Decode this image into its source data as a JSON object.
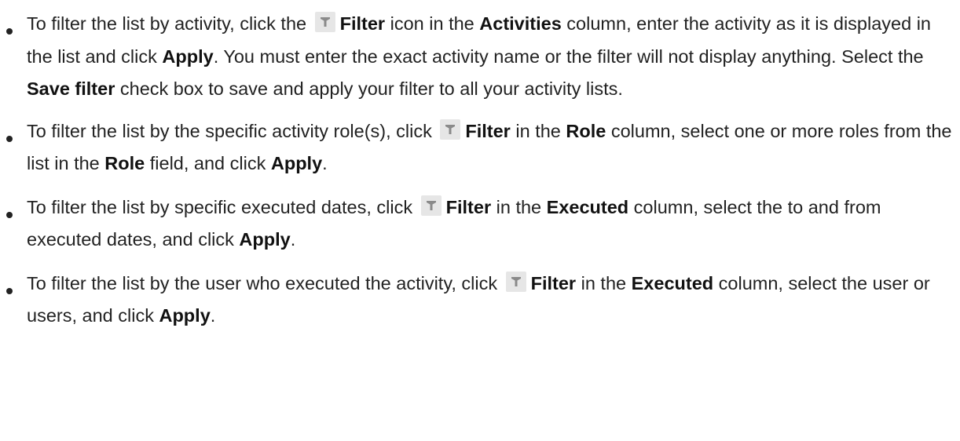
{
  "bullets": [
    {
      "segments": [
        {
          "t": "text",
          "v": "To filter the list by activity, click the "
        },
        {
          "t": "icon",
          "v": "filter-icon"
        },
        {
          "t": "bold",
          "v": "Filter"
        },
        {
          "t": "text",
          "v": " icon in the "
        },
        {
          "t": "bold",
          "v": "Activities"
        },
        {
          "t": "text",
          "v": " column, enter the activity as it is displayed in the list and click "
        },
        {
          "t": "bold",
          "v": "Apply"
        },
        {
          "t": "text",
          "v": ". You must enter the exact activity name or the filter will not display anything. Select the "
        },
        {
          "t": "bold",
          "v": "Save filter"
        },
        {
          "t": "text",
          "v": " check box to save and apply your filter to all your activity lists."
        }
      ]
    },
    {
      "segments": [
        {
          "t": "text",
          "v": "To filter the list by the specific activity role(s), click "
        },
        {
          "t": "icon",
          "v": "filter-icon"
        },
        {
          "t": "bold",
          "v": "Filter"
        },
        {
          "t": "text",
          "v": " in the "
        },
        {
          "t": "bold",
          "v": "Role"
        },
        {
          "t": "text",
          "v": " column, select one or more roles from the list in the "
        },
        {
          "t": "bold",
          "v": "Role"
        },
        {
          "t": "text",
          "v": " field, and click "
        },
        {
          "t": "bold",
          "v": "Apply"
        },
        {
          "t": "text",
          "v": "."
        }
      ]
    },
    {
      "segments": [
        {
          "t": "text",
          "v": "To filter the list by specific executed dates, click "
        },
        {
          "t": "icon",
          "v": "filter-icon"
        },
        {
          "t": "bold",
          "v": "Filter"
        },
        {
          "t": "text",
          "v": " in the "
        },
        {
          "t": "bold",
          "v": "Executed"
        },
        {
          "t": "text",
          "v": " column, select the to and from executed dates, and click "
        },
        {
          "t": "bold",
          "v": "Apply"
        },
        {
          "t": "text",
          "v": "."
        }
      ]
    },
    {
      "segments": [
        {
          "t": "text",
          "v": "To filter the list by the user who executed the activity, click "
        },
        {
          "t": "icon",
          "v": "filter-icon"
        },
        {
          "t": "bold",
          "v": "Filter"
        },
        {
          "t": "text",
          "v": " in the "
        },
        {
          "t": "bold",
          "v": "Executed"
        },
        {
          "t": "text",
          "v": " column, select the user or users, and click "
        },
        {
          "t": "bold",
          "v": "Apply"
        },
        {
          "t": "text",
          "v": "."
        }
      ]
    }
  ],
  "colors": {
    "text": "#222222",
    "bold_text": "#111111",
    "icon_bg": "#e6e6e6",
    "icon_glyph": "#8a8a8a"
  }
}
